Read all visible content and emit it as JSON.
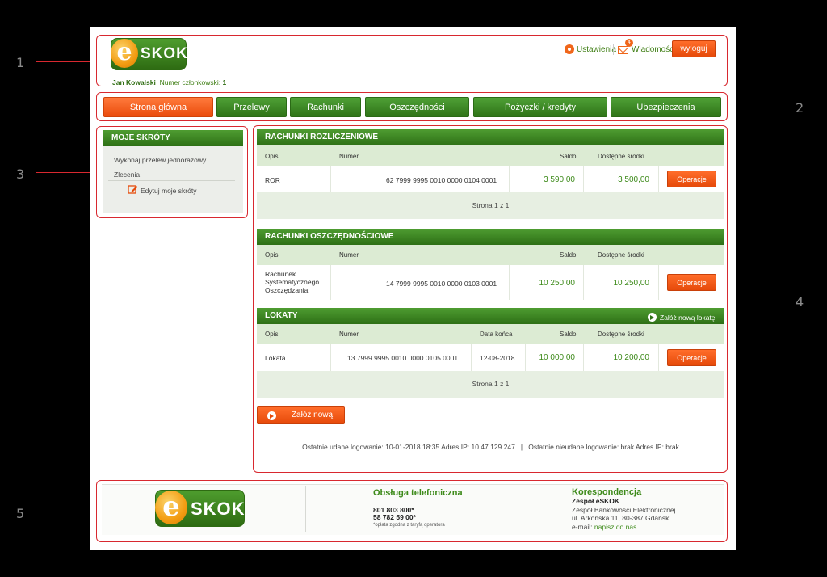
{
  "callouts": [
    "1",
    "2",
    "3",
    "4",
    "5"
  ],
  "header": {
    "logo": {
      "e": "e",
      "text": "SKOK"
    },
    "settings_label": "Ustawienia",
    "messages_label": "Wiadomości",
    "messages_badge": "4",
    "logout_label": "wyloguj",
    "user_name": "Jan Kowalski",
    "member_label": "Numer członkowski:",
    "member_no": "1"
  },
  "nav": {
    "tabs": [
      {
        "label": "Strona główna",
        "active": true
      },
      {
        "label": "Przelewy"
      },
      {
        "label": "Rachunki"
      },
      {
        "label": "Oszczędności"
      },
      {
        "label": "Pożyczki / kredyty"
      },
      {
        "label": "Ubezpieczenia"
      }
    ]
  },
  "shortcuts": {
    "title": "MOJE SKRÓTY",
    "items": [
      "Wykonaj przelew jednorazowy",
      "Zlecenia"
    ],
    "edit_label": "Edytuj moje skróty"
  },
  "accounts": {
    "settlement": {
      "title": "RACHUNKI ROZLICZENIOWE",
      "headers": {
        "opis": "Opis",
        "numer": "Numer",
        "saldo": "Saldo",
        "dostepne": "Dostępne środki"
      },
      "rows": [
        {
          "opis": "ROR",
          "numer": "62 7999 9995 0010 0000 0104 0001",
          "saldo": "3 590,00",
          "dostepne": "3 500,00",
          "action": "Operacje"
        }
      ],
      "pager": "Strona 1 z 1"
    },
    "savings": {
      "title": "RACHUNKI OSZCZĘDNOŚCIOWE",
      "headers": {
        "opis": "Opis",
        "numer": "Numer",
        "saldo": "Saldo",
        "dostepne": "Dostępne środki"
      },
      "rows": [
        {
          "opis_lines": [
            "Rachunek",
            "Systematycznego",
            "Oszczędzania"
          ],
          "numer": "14 7999 9995 0010 0000 0103 0001",
          "saldo": "10 250,00",
          "dostepne": "10 250,00",
          "action": "Operacje"
        }
      ]
    },
    "deposits": {
      "title": "LOKATY",
      "new_link": "Załóż nową lokatę",
      "headers": {
        "opis": "Opis",
        "numer": "Numer",
        "data": "Data końca",
        "saldo": "Saldo",
        "dostepne": "Dostępne środki"
      },
      "rows": [
        {
          "opis": "Lokata",
          "numer": "13 7999 9995 0010 0000 0105 0001",
          "data": "12-08-2018",
          "saldo": "10 000,00",
          "dostepne": "10 200,00",
          "action": "Operacje"
        }
      ],
      "pager": "Strona 1 z 1"
    },
    "new_deposit_button": "Załóż nową lokatę",
    "login_info": "Ostatnie udane logowanie: 10-01-2018 18:35 Adres IP: 10.47.129.247   |   Ostatnie nieudane logowanie: brak Adres IP: brak"
  },
  "footer": {
    "phone_title": "Obsługa telefoniczna",
    "phones": [
      "801 803 800*",
      "58 782 59 00*"
    ],
    "phone_note": "*opłata zgodna z taryfą operatora",
    "corr_title": "Korespondencja",
    "corr_name": "Zespół eSKOK",
    "corr_lines": [
      "Zespół Bankowości Elektronicznej",
      "ul. Arkońska 11, 80-387 Gdańsk"
    ],
    "email_label": "e-mail:",
    "email_link": "napisz do nas"
  }
}
